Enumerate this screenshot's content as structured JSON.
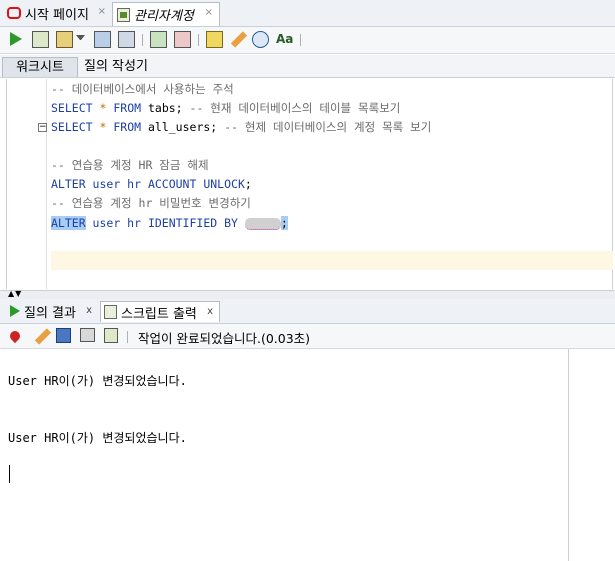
{
  "doc_tabs": [
    {
      "label": "시작 페이지",
      "close": "×"
    },
    {
      "label": "관리자계정",
      "close": "×"
    }
  ],
  "toolbar": {
    "icons": [
      "run-statement-icon",
      "run-script-icon",
      "autotrace-icon",
      "commit-icon",
      "rollback-icon",
      "sql-tuning-icon",
      "clear-icon",
      "history-icon",
      "format-icon",
      "dropdown-icon"
    ]
  },
  "subtabs": {
    "worksheet": "워크시트",
    "query_builder": "질의 작성기"
  },
  "editor": {
    "lines": {
      "l1": "-- 데이터베이스에서 사용하는 주석",
      "l2_kw1": "SELECT",
      "l2_star": "*",
      "l2_kw2": "FROM",
      "l2_rest": " tabs; ",
      "l2_comment": "-- 현재 데이터베이스의 테이블 목록보기",
      "l3_kw1": "SELECT",
      "l3_star": "*",
      "l3_kw2": "FROM",
      "l3_rest": " all_users; ",
      "l3_comment": "-- 현제 데이터베이스의 계정 목록 보기",
      "l5": "-- 연습용 계정 HR 잠금 해제",
      "l6_kw1": "ALTER",
      "l6_mid": " user hr ",
      "l6_kw2": "ACCOUNT UNLOCK",
      "l6_end": ";",
      "l7": "-- 연습용 계정 hr 비밀번호 변경하기",
      "l8_kw1": "ALTER",
      "l8_mid": " user hr ",
      "l8_kw2": "IDENTIFIED BY",
      "l8_end": ";"
    },
    "fold_symbol": "−"
  },
  "bottom_tabs": [
    {
      "label": "질의 결과",
      "close": "x"
    },
    {
      "label": "스크립트 출력",
      "close": "x"
    }
  ],
  "output_toolbar": {
    "icons": [
      "pin-icon",
      "clear-output-icon",
      "save-icon",
      "print-icon",
      "output-script-icon"
    ],
    "status": "작업이 완료되었습니다.(0.03초)"
  },
  "output": {
    "lines": [
      "User HR이(가) 변경되었습니다.",
      "User HR이(가) 변경되었습니다."
    ]
  },
  "splitter_arrows": "▲▼"
}
